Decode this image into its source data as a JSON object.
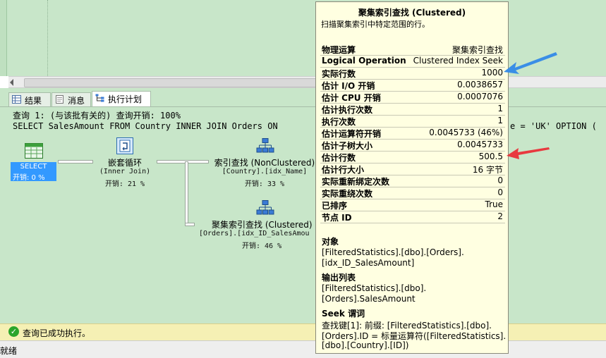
{
  "tabs": [
    {
      "label": "结果",
      "icon": "grid-icon"
    },
    {
      "label": "消息",
      "icon": "message-icon"
    },
    {
      "label": "执行计划",
      "icon": "execution-plan-icon"
    }
  ],
  "plan": {
    "header_line1": "查询 1: (与该批有关的) 查询开销: 100%",
    "header_line2": "SELECT SalesAmount FROM Country INNER JOIN Orders ON",
    "header_line2_tail": "e = 'UK' OPTION (",
    "operators": {
      "select": {
        "label": "SELECT",
        "cost": "开销: 0 %"
      },
      "nested_loops": {
        "label": "嵌套循环",
        "sub": "(Inner Join)",
        "cost": "开销: 21 %"
      },
      "index_seek": {
        "label": "索引查找 (NonClustered)",
        "sub": "[Country].[idx_Name]",
        "cost": "开销: 33 %"
      },
      "clustered_seek": {
        "label": "聚集索引查找 (Clustered)",
        "sub": "[Orders].[idx_ID_SalesAmou",
        "cost": "开销: 46 %"
      }
    }
  },
  "status": {
    "message": "查询已成功执行。",
    "footer": "就绪"
  },
  "tooltip": {
    "title": "聚集索引查找 (Clustered)",
    "description": "扫描聚集索引中特定范围的行。",
    "properties": [
      {
        "key": "物理运算",
        "value": "聚集索引查找"
      },
      {
        "key": "Logical Operation",
        "value": "Clustered Index Seek"
      },
      {
        "key": "实际行数",
        "value": "1000"
      },
      {
        "key": "估计 I/O 开销",
        "value": "0.0038657"
      },
      {
        "key": "估计 CPU 开销",
        "value": "0.0007076"
      },
      {
        "key": "估计执行次数",
        "value": "1"
      },
      {
        "key": "执行次数",
        "value": "1"
      },
      {
        "key": "估计运算符开销",
        "value": "0.0045733 (46%)"
      },
      {
        "key": "估计子树大小",
        "value": "0.0045733"
      },
      {
        "key": "估计行数",
        "value": "500.5"
      },
      {
        "key": "估计行大小",
        "value": "16 字节"
      },
      {
        "key": "实际重新绑定次数",
        "value": "0"
      },
      {
        "key": "实际重绕次数",
        "value": "0"
      },
      {
        "key": "已排序",
        "value": "True"
      },
      {
        "key": "节点 ID",
        "value": "2"
      }
    ],
    "object_heading": "对象",
    "object_lines": [
      "[FilteredStatistics].[dbo].[Orders].",
      "[idx_ID_SalesAmount]"
    ],
    "output_heading": "输出列表",
    "output_lines": [
      "[FilteredStatistics].[dbo].",
      "[Orders].SalesAmount"
    ],
    "seek_heading": "Seek 谓词",
    "seek_lines": [
      "查找键[1]: 前缀: [FilteredStatistics].[dbo].",
      "[Orders].ID = 标量运算符([FilteredStatistics].",
      "[dbo].[Country].[ID])"
    ]
  },
  "colors": {
    "plan_background": "#c8e6c9",
    "tooltip_background": "#ffffe1",
    "selected_operator": "#3399ff",
    "blue_arrow": "#3a8ee6",
    "red_arrow": "#e8393f",
    "status_background": "#f5f0b4"
  }
}
